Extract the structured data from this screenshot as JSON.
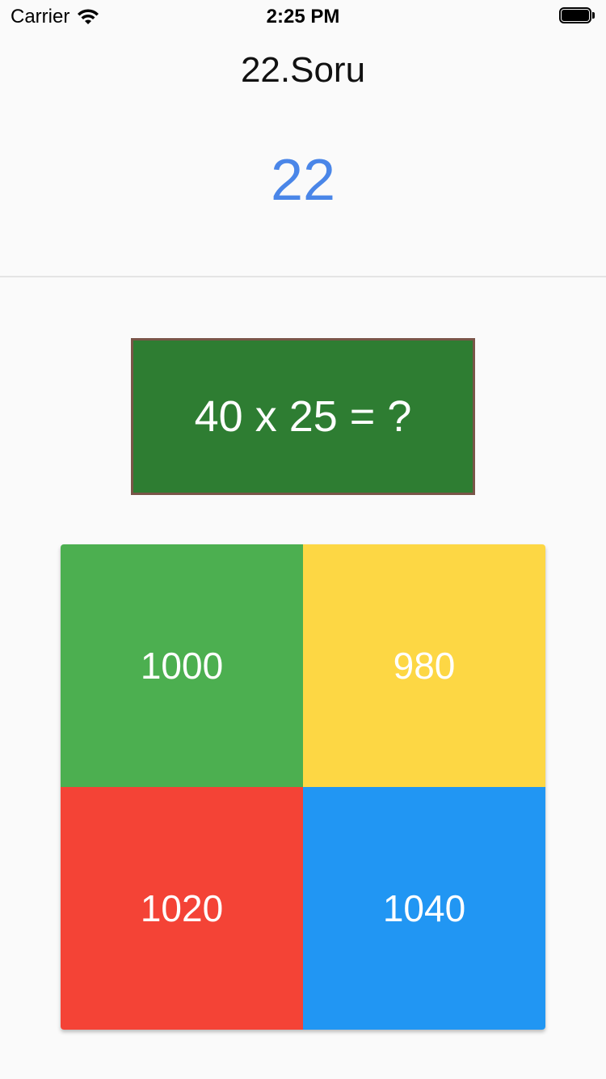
{
  "status_bar": {
    "carrier": "Carrier",
    "time": "2:25 PM",
    "wifi_icon": "wifi-icon",
    "battery_icon": "battery-icon"
  },
  "header": {
    "question_title": "22.Soru",
    "timer_value": "22",
    "timer_color": "#4a86e8"
  },
  "question": {
    "text": "40 x 25 = ?",
    "board_color": "#2e7d32",
    "board_border_color": "#795548"
  },
  "answers": [
    {
      "label": "1000",
      "color": "#4caf50"
    },
    {
      "label": "980",
      "color": "#fdd744"
    },
    {
      "label": "1020",
      "color": "#f44336"
    },
    {
      "label": "1040",
      "color": "#2196f3"
    }
  ]
}
